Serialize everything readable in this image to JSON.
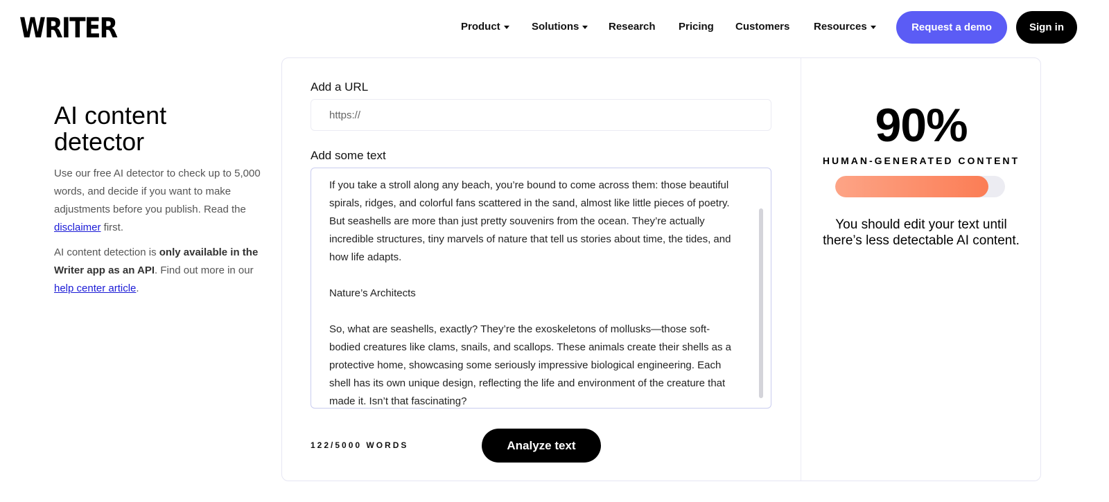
{
  "header": {
    "logo": "WRITER",
    "nav": [
      {
        "label": "Product",
        "has_caret": true
      },
      {
        "label": "Solutions",
        "has_caret": true
      },
      {
        "label": "Research",
        "has_caret": false
      },
      {
        "label": "Pricing",
        "has_caret": false
      },
      {
        "label": "Customers",
        "has_caret": false
      },
      {
        "label": "Resources",
        "has_caret": true
      }
    ],
    "demo_button": "Request a demo",
    "signin_button": "Sign in"
  },
  "intro": {
    "title": "AI content detector",
    "p1_text": "Use our free AI detector to check up to 5,000 words, and decide if you want to make adjustments before you publish. Read the ",
    "p1_link": "disclaimer",
    "p1_end": " first.",
    "p2_start": "AI content detection is ",
    "p2_bold": "only available in the Writer app as an API",
    "p2_mid": ". Find out more in our ",
    "p2_link": "help center article",
    "p2_end": "."
  },
  "form": {
    "url_label": "Add a URL",
    "url_placeholder": "https://",
    "text_label": "Add some text",
    "text_paragraphs": [
      "If you take a stroll along any beach, you’re bound to come across them: those beautiful spirals, ridges, and colorful fans scattered in the sand, almost like little pieces of poetry. But seashells are more than just pretty souvenirs from the ocean. They’re actually incredible structures, tiny marvels of nature that tell us stories about time, the tides, and how life adapts.",
      "Nature’s Architects",
      "So, what are seashells, exactly? They’re the exoskeletons of mollusks—those soft-bodied creatures like clams, snails, and scallops. These animals create their shells as a protective home, showcasing some seriously impressive biological engineering. Each shell has its own unique design, reflecting the life and environment of the creature that made it. Isn’t that fascinating?"
    ],
    "word_count": "122/5000 WORDS",
    "analyze_button": "Analyze text"
  },
  "result": {
    "percent": "90%",
    "label": "HUMAN-GENERATED CONTENT",
    "fill_fraction": 0.9,
    "bar_color": "#fb7d55",
    "verdict": "You should edit your text until there’s less detectable AI content."
  },
  "colors": {
    "accent": "#5b5cf5",
    "dark_button": "#000000"
  }
}
